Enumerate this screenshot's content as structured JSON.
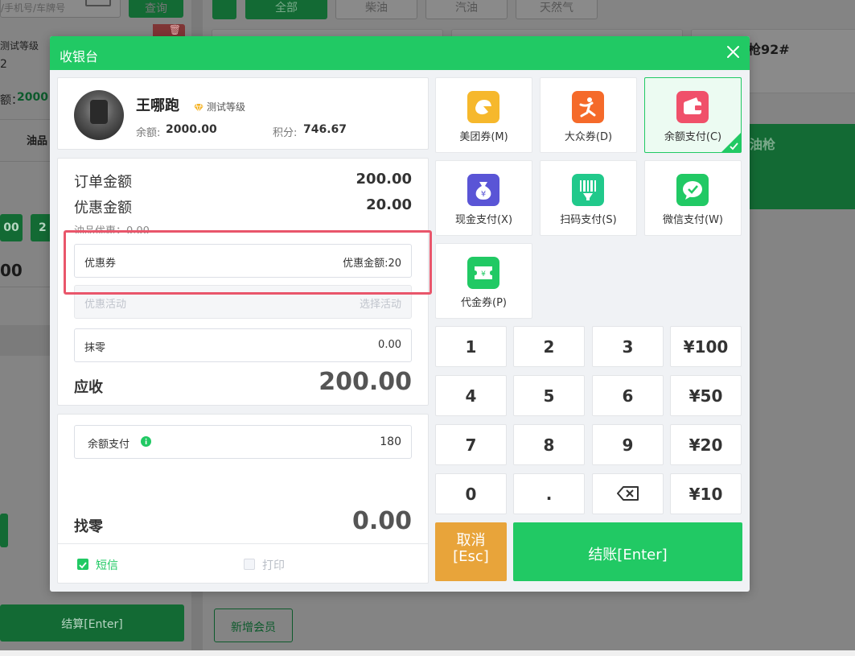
{
  "background": {
    "search_placeholder": "/手机号/车牌号",
    "query_button": "查询",
    "member_level": "测试等级",
    "member_number": "2",
    "balance_label": "额：",
    "balance_value": "2000",
    "oil_product_header": "油品",
    "amount_chip_1": "00",
    "amount_chip_2": "2",
    "amount_big": "00",
    "settle_button": "结算[Enter]",
    "fuel_tabs": [
      "全部",
      "柴油",
      "汽油",
      "天然气"
    ],
    "gun_label": "枪92#",
    "gun_title": "油枪",
    "new_member_button": "新增会员"
  },
  "modal": {
    "title": "收银台",
    "member": {
      "name": "王哪跑",
      "level": "测试等级",
      "balance_label": "余额:",
      "balance_value": "2000.00",
      "points_label": "积分:",
      "points_value": "746.67"
    },
    "order": {
      "order_amount_label": "订单金额",
      "order_amount_value": "200.00",
      "discount_amount_label": "优惠金额",
      "discount_amount_value": "20.00",
      "oil_discount_label": "油品优惠：0.00",
      "coupon_label": "优惠券",
      "coupon_value": "优惠金额:20",
      "activity_label": "优惠活动",
      "activity_placeholder": "选择活动",
      "rounding_label": "抹零",
      "rounding_value": "0.00",
      "amount_due_label": "应收",
      "amount_due_value": "200.00"
    },
    "payment": {
      "method_label": "余额支付",
      "method_value": "180",
      "change_label": "找零",
      "change_value": "0.00",
      "sms_label": "短信",
      "sms_checked": true,
      "print_label": "打印",
      "print_checked": false
    },
    "methods": [
      {
        "label": "美团券(M)",
        "icon": "meituan-icon",
        "color": "#f6b82c",
        "active": false
      },
      {
        "label": "大众券(D)",
        "icon": "dianping-icon",
        "color": "#f56a2a",
        "active": false
      },
      {
        "label": "余额支付(C)",
        "icon": "wallet-icon",
        "color": "#f0506a",
        "active": true
      },
      {
        "label": "现金支付(X)",
        "icon": "money-bag-icon",
        "color": "#5a55d6",
        "active": false
      },
      {
        "label": "扫码支付(S)",
        "icon": "barcode-scan-icon",
        "color": "#21c98b",
        "active": false
      },
      {
        "label": "微信支付(W)",
        "icon": "wechat-icon",
        "color": "#21c964",
        "active": false
      },
      {
        "label": "代金券(P)",
        "icon": "voucher-icon",
        "color": "#21c964",
        "active": false
      }
    ],
    "keypad": {
      "keys": [
        "1",
        "2",
        "3",
        "¥100",
        "4",
        "5",
        "6",
        "¥50",
        "7",
        "8",
        "9",
        "¥20",
        "0",
        ".",
        "",
        "¥10"
      ],
      "cancel_label": "取消\n[Esc]",
      "cancel_line1": "取消",
      "cancel_line2": "[Esc]",
      "checkout_label": "结账[Enter]"
    },
    "colors": {
      "primary": "#21c964",
      "cancel": "#e8a43a",
      "highlight": "#e9566b"
    }
  }
}
